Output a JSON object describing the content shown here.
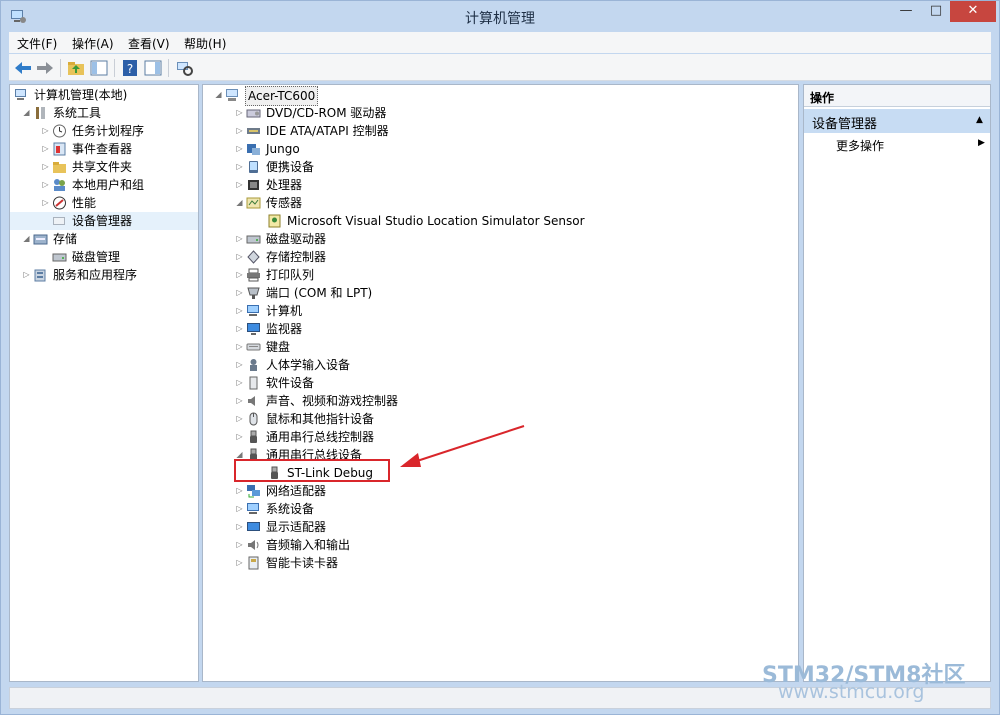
{
  "window": {
    "title": "计算机管理",
    "min": "—",
    "max": "□",
    "close": "✕"
  },
  "menu": [
    "文件(F)",
    "操作(A)",
    "查看(V)",
    "帮助(H)"
  ],
  "colors": {
    "titlebar": "#c3d7ef",
    "close": "#c7463f",
    "highlight": "#d9262b",
    "selected": "#c7dcf3"
  },
  "toolbar": {
    "icons": [
      "back-arrow-icon",
      "forward-arrow-icon",
      "up-folder-icon",
      "show-hide-tree-icon",
      "help-icon",
      "action-pane-icon",
      "device-scan-icon"
    ]
  },
  "left_tree": [
    {
      "label": "计算机管理(本地)",
      "expander": "",
      "icon": "computer-management-icon"
    },
    {
      "label": "系统工具",
      "expander": "◢",
      "icon": "tools-icon"
    },
    {
      "label": "任务计划程序",
      "expander": "▷",
      "icon": "clock-icon"
    },
    {
      "label": "事件查看器",
      "expander": "▷",
      "icon": "event-viewer-icon"
    },
    {
      "label": "共享文件夹",
      "expander": "▷",
      "icon": "shared-folder-icon"
    },
    {
      "label": "本地用户和组",
      "expander": "▷",
      "icon": "users-icon"
    },
    {
      "label": "性能",
      "expander": "▷",
      "icon": "performance-icon"
    },
    {
      "label": "设备管理器",
      "expander": "",
      "icon": "device-manager-icon"
    },
    {
      "label": "存储",
      "expander": "◢",
      "icon": "storage-icon"
    },
    {
      "label": "磁盘管理",
      "expander": "",
      "icon": "disk-icon"
    },
    {
      "label": "服务和应用程序",
      "expander": "▷",
      "icon": "services-icon"
    }
  ],
  "device_tree": [
    {
      "label": "Acer-TC600",
      "expander": "◢",
      "icon": "computer-icon"
    },
    {
      "label": "DVD/CD-ROM 驱动器",
      "expander": "▷",
      "icon": "dvd-icon"
    },
    {
      "label": "IDE ATA/ATAPI 控制器",
      "expander": "▷",
      "icon": "ide-icon"
    },
    {
      "label": "Jungo",
      "expander": "▷",
      "icon": "jungo-icon"
    },
    {
      "label": "便携设备",
      "expander": "▷",
      "icon": "portable-device-icon"
    },
    {
      "label": "处理器",
      "expander": "▷",
      "icon": "processor-icon"
    },
    {
      "label": "传感器",
      "expander": "◢",
      "icon": "sensor-icon"
    },
    {
      "label": "Microsoft Visual Studio Location Simulator Sensor",
      "expander": "",
      "icon": "location-sensor-icon"
    },
    {
      "label": "磁盘驱动器",
      "expander": "▷",
      "icon": "disk-drive-icon"
    },
    {
      "label": "存储控制器",
      "expander": "▷",
      "icon": "storage-controller-icon"
    },
    {
      "label": "打印队列",
      "expander": "▷",
      "icon": "printer-icon"
    },
    {
      "label": "端口 (COM 和 LPT)",
      "expander": "▷",
      "icon": "port-icon"
    },
    {
      "label": "计算机",
      "expander": "▷",
      "icon": "pc-icon"
    },
    {
      "label": "监视器",
      "expander": "▷",
      "icon": "monitor-icon"
    },
    {
      "label": "键盘",
      "expander": "▷",
      "icon": "keyboard-icon"
    },
    {
      "label": "人体学输入设备",
      "expander": "▷",
      "icon": "hid-icon"
    },
    {
      "label": "软件设备",
      "expander": "▷",
      "icon": "software-device-icon"
    },
    {
      "label": "声音、视频和游戏控制器",
      "expander": "▷",
      "icon": "sound-icon"
    },
    {
      "label": "鼠标和其他指针设备",
      "expander": "▷",
      "icon": "mouse-icon"
    },
    {
      "label": "通用串行总线控制器",
      "expander": "▷",
      "icon": "usb-icon"
    },
    {
      "label": "通用串行总线设备",
      "expander": "◢",
      "icon": "usb-icon"
    },
    {
      "label": "ST-Link Debug",
      "expander": "",
      "icon": "usb-device-icon"
    },
    {
      "label": "网络适配器",
      "expander": "▷",
      "icon": "network-icon"
    },
    {
      "label": "系统设备",
      "expander": "▷",
      "icon": "system-device-icon"
    },
    {
      "label": "显示适配器",
      "expander": "▷",
      "icon": "display-adapter-icon"
    },
    {
      "label": "音频输入和输出",
      "expander": "▷",
      "icon": "audio-io-icon"
    },
    {
      "label": "智能卡读卡器",
      "expander": "▷",
      "icon": "smart-card-icon"
    }
  ],
  "actions": {
    "header": "操作",
    "selected": "设备管理器",
    "more": "更多操作"
  },
  "watermark": {
    "line1": "STM32/STM8社区",
    "line2": "www.stmcu.org"
  }
}
